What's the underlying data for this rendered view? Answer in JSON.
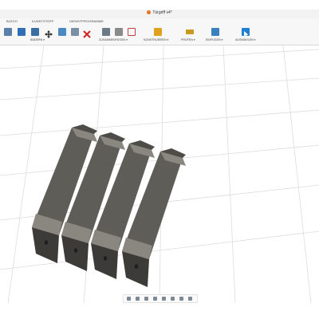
{
  "window": {
    "title": "Türgriff v4*"
  },
  "tabs": [
    "BLECH",
    "KUNSTSTOFF",
    "DIENSTPROGRAMME"
  ],
  "toolbar": {
    "groups": [
      "ÄNDERN ▾",
      "ZUSAMMENFÜGEN ▾",
      "KONSTRUIEREN ▾",
      "PRÜFEN ▾",
      "EINFÜGEN ▾",
      "AUSWÄHLEN ▾"
    ],
    "icons": [
      {
        "name": "sketch-icon",
        "color": "#5a7fa8"
      },
      {
        "name": "extrude-icon",
        "color": "#2f6fb5"
      },
      {
        "name": "shell-icon",
        "color": "#3b6fa0"
      },
      {
        "name": "move-icon",
        "color": "#2d2d2d"
      },
      {
        "name": "combine-icon",
        "color": "#4a8ac0"
      },
      {
        "name": "delete-icon",
        "color": "#d02a2a"
      },
      {
        "name": "new-component-icon",
        "color": "#6a7a8a"
      },
      {
        "name": "joint-icon",
        "color": "#7a7a7a"
      },
      {
        "name": "as-built-joint-icon",
        "color": "#c04040"
      },
      {
        "name": "offset-plane-icon",
        "color": "#e0a020"
      },
      {
        "name": "measure-icon",
        "color": "#c89a20"
      },
      {
        "name": "insert-image-icon",
        "color": "#3a80c0"
      },
      {
        "name": "select-icon",
        "color": "#1f7fd0"
      }
    ]
  },
  "viewport": {
    "model_color": "#5f5d58",
    "highlight_color": "#8a8780",
    "grid_color": "#dcdcdc"
  },
  "navbar": {
    "icons": [
      "orbit-icon",
      "look-at-icon",
      "pan-icon",
      "zoom-icon",
      "fit-icon",
      "display-settings-icon",
      "grid-icon",
      "viewports-icon"
    ]
  }
}
